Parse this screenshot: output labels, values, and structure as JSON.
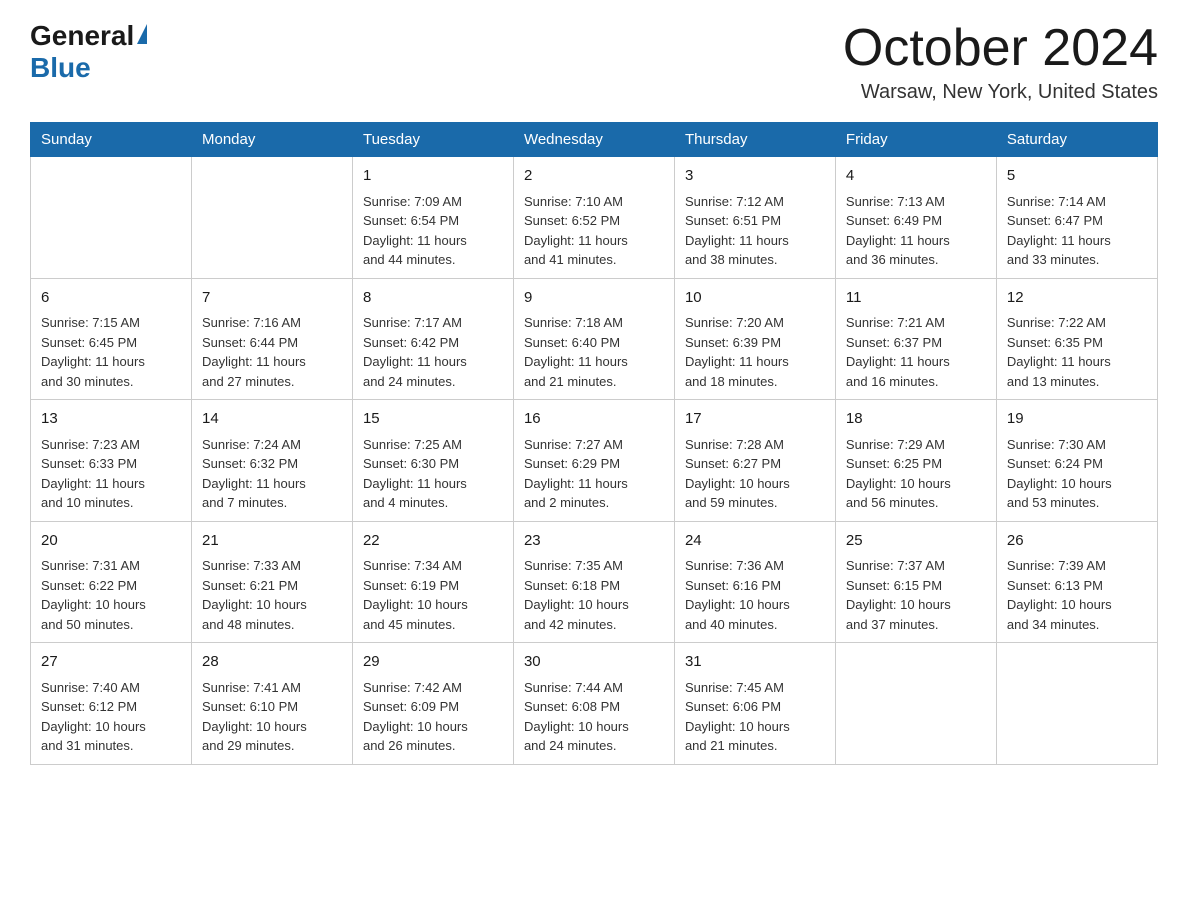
{
  "header": {
    "logo_general": "General",
    "logo_blue": "Blue",
    "month_title": "October 2024",
    "location": "Warsaw, New York, United States"
  },
  "weekdays": [
    "Sunday",
    "Monday",
    "Tuesday",
    "Wednesday",
    "Thursday",
    "Friday",
    "Saturday"
  ],
  "weeks": [
    [
      {
        "day": "",
        "info": ""
      },
      {
        "day": "",
        "info": ""
      },
      {
        "day": "1",
        "info": "Sunrise: 7:09 AM\nSunset: 6:54 PM\nDaylight: 11 hours\nand 44 minutes."
      },
      {
        "day": "2",
        "info": "Sunrise: 7:10 AM\nSunset: 6:52 PM\nDaylight: 11 hours\nand 41 minutes."
      },
      {
        "day": "3",
        "info": "Sunrise: 7:12 AM\nSunset: 6:51 PM\nDaylight: 11 hours\nand 38 minutes."
      },
      {
        "day": "4",
        "info": "Sunrise: 7:13 AM\nSunset: 6:49 PM\nDaylight: 11 hours\nand 36 minutes."
      },
      {
        "day": "5",
        "info": "Sunrise: 7:14 AM\nSunset: 6:47 PM\nDaylight: 11 hours\nand 33 minutes."
      }
    ],
    [
      {
        "day": "6",
        "info": "Sunrise: 7:15 AM\nSunset: 6:45 PM\nDaylight: 11 hours\nand 30 minutes."
      },
      {
        "day": "7",
        "info": "Sunrise: 7:16 AM\nSunset: 6:44 PM\nDaylight: 11 hours\nand 27 minutes."
      },
      {
        "day": "8",
        "info": "Sunrise: 7:17 AM\nSunset: 6:42 PM\nDaylight: 11 hours\nand 24 minutes."
      },
      {
        "day": "9",
        "info": "Sunrise: 7:18 AM\nSunset: 6:40 PM\nDaylight: 11 hours\nand 21 minutes."
      },
      {
        "day": "10",
        "info": "Sunrise: 7:20 AM\nSunset: 6:39 PM\nDaylight: 11 hours\nand 18 minutes."
      },
      {
        "day": "11",
        "info": "Sunrise: 7:21 AM\nSunset: 6:37 PM\nDaylight: 11 hours\nand 16 minutes."
      },
      {
        "day": "12",
        "info": "Sunrise: 7:22 AM\nSunset: 6:35 PM\nDaylight: 11 hours\nand 13 minutes."
      }
    ],
    [
      {
        "day": "13",
        "info": "Sunrise: 7:23 AM\nSunset: 6:33 PM\nDaylight: 11 hours\nand 10 minutes."
      },
      {
        "day": "14",
        "info": "Sunrise: 7:24 AM\nSunset: 6:32 PM\nDaylight: 11 hours\nand 7 minutes."
      },
      {
        "day": "15",
        "info": "Sunrise: 7:25 AM\nSunset: 6:30 PM\nDaylight: 11 hours\nand 4 minutes."
      },
      {
        "day": "16",
        "info": "Sunrise: 7:27 AM\nSunset: 6:29 PM\nDaylight: 11 hours\nand 2 minutes."
      },
      {
        "day": "17",
        "info": "Sunrise: 7:28 AM\nSunset: 6:27 PM\nDaylight: 10 hours\nand 59 minutes."
      },
      {
        "day": "18",
        "info": "Sunrise: 7:29 AM\nSunset: 6:25 PM\nDaylight: 10 hours\nand 56 minutes."
      },
      {
        "day": "19",
        "info": "Sunrise: 7:30 AM\nSunset: 6:24 PM\nDaylight: 10 hours\nand 53 minutes."
      }
    ],
    [
      {
        "day": "20",
        "info": "Sunrise: 7:31 AM\nSunset: 6:22 PM\nDaylight: 10 hours\nand 50 minutes."
      },
      {
        "day": "21",
        "info": "Sunrise: 7:33 AM\nSunset: 6:21 PM\nDaylight: 10 hours\nand 48 minutes."
      },
      {
        "day": "22",
        "info": "Sunrise: 7:34 AM\nSunset: 6:19 PM\nDaylight: 10 hours\nand 45 minutes."
      },
      {
        "day": "23",
        "info": "Sunrise: 7:35 AM\nSunset: 6:18 PM\nDaylight: 10 hours\nand 42 minutes."
      },
      {
        "day": "24",
        "info": "Sunrise: 7:36 AM\nSunset: 6:16 PM\nDaylight: 10 hours\nand 40 minutes."
      },
      {
        "day": "25",
        "info": "Sunrise: 7:37 AM\nSunset: 6:15 PM\nDaylight: 10 hours\nand 37 minutes."
      },
      {
        "day": "26",
        "info": "Sunrise: 7:39 AM\nSunset: 6:13 PM\nDaylight: 10 hours\nand 34 minutes."
      }
    ],
    [
      {
        "day": "27",
        "info": "Sunrise: 7:40 AM\nSunset: 6:12 PM\nDaylight: 10 hours\nand 31 minutes."
      },
      {
        "day": "28",
        "info": "Sunrise: 7:41 AM\nSunset: 6:10 PM\nDaylight: 10 hours\nand 29 minutes."
      },
      {
        "day": "29",
        "info": "Sunrise: 7:42 AM\nSunset: 6:09 PM\nDaylight: 10 hours\nand 26 minutes."
      },
      {
        "day": "30",
        "info": "Sunrise: 7:44 AM\nSunset: 6:08 PM\nDaylight: 10 hours\nand 24 minutes."
      },
      {
        "day": "31",
        "info": "Sunrise: 7:45 AM\nSunset: 6:06 PM\nDaylight: 10 hours\nand 21 minutes."
      },
      {
        "day": "",
        "info": ""
      },
      {
        "day": "",
        "info": ""
      }
    ]
  ]
}
